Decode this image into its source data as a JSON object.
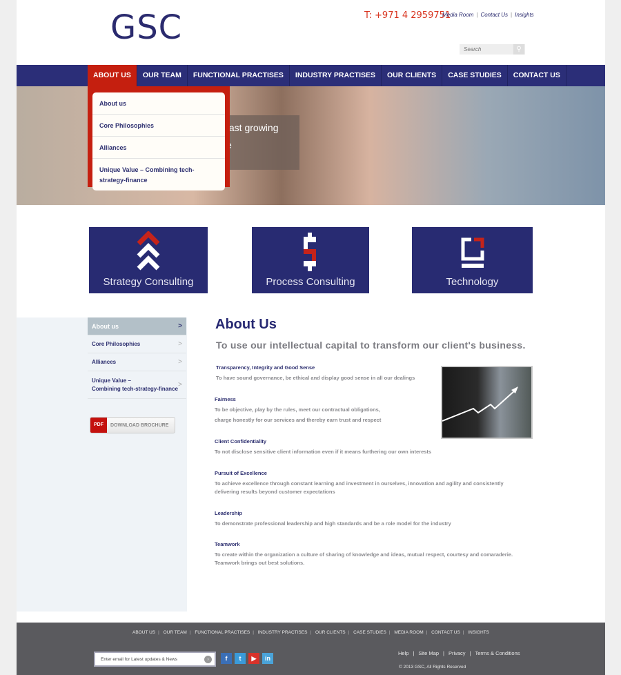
{
  "header": {
    "logo": "GSC",
    "phone": "T: +971 4 2959751",
    "top_links": [
      "Media Room",
      "Contact Us",
      "Insights"
    ],
    "search_placeholder": "Search"
  },
  "nav": {
    "items": [
      "ABOUT US",
      "OUR TEAM",
      "FUNCTIONAL PRACTISES",
      "INDUSTRY PRACTISES",
      "OUR CLIENTS",
      "CASE STUDIES",
      "CONTACT US"
    ],
    "active": "ABOUT US"
  },
  "dropdown": {
    "items": [
      "About us",
      "Core Philosophies",
      "Alliances",
      "Unique Value – Combining tech-strategy-finance"
    ]
  },
  "hero": {
    "caption_line1": "fast growing",
    "caption_line2": "e"
  },
  "tiles": [
    {
      "label": "Strategy Consulting",
      "icon": "chevrons-up-icon"
    },
    {
      "label": "Process Consulting",
      "icon": "dollar-icon"
    },
    {
      "label": "Technology",
      "icon": "technology-frame-icon"
    }
  ],
  "sidebar": {
    "items": [
      "About us",
      "Core Philosophies",
      "Alliances",
      "Unique Value –",
      "Combining tech-strategy-finance"
    ],
    "pdf_tag": "PDF",
    "pdf_label": "DOWNLOAD BROCHURE"
  },
  "main": {
    "title": "About Us",
    "subtitle": "To use our intellectual capital to transform our client's business.",
    "values": [
      {
        "title": "Transparency, Integrity and Good Sense",
        "lines": [
          "To have sound governance, be ethical and display good sense in all our dealings"
        ]
      },
      {
        "title": "Fairness",
        "lines": [
          "To be objective, play by the rules, meet our contractual obligations,",
          "charge honestly for our services and thereby earn trust and respect"
        ]
      },
      {
        "title": "Client Confidentiality",
        "lines": [
          "To not disclose sensitive client information even if it means furthering our own interests"
        ]
      },
      {
        "title": "Pursuit of Excellence",
        "lines": [
          "To achieve excellence through constant learning and investment in ourselves, innovation and agility and consistently",
          "delivering results beyond customer expectations"
        ]
      },
      {
        "title": "Leadership",
        "lines": [
          "To demonstrate professional leadership and high standards and be a role model for the industry"
        ]
      },
      {
        "title": "Teamwork",
        "lines": [
          "To create within the organization a culture of sharing of knowledge and ideas, mutual respect, courtesy and comaraderie.",
          "Teamwork brings out best solutions."
        ]
      }
    ]
  },
  "footer": {
    "links": [
      "ABOUT US",
      "OUR TEAM",
      "FUNCTIONAL PRACTISES",
      "INDUSTRY PRACTISES",
      "OUR CLIENTS",
      "CASE STUDIES",
      "MEDIA ROOM",
      "CONTACT US",
      "INSIGHTS"
    ],
    "email_placeholder": "Enter email for Latest updates & News",
    "social": [
      {
        "name": "facebook-icon",
        "glyph": "f",
        "color": "#3b6fb6"
      },
      {
        "name": "twitter-icon",
        "glyph": "t",
        "color": "#3a9ad9"
      },
      {
        "name": "youtube-icon",
        "glyph": "▶",
        "color": "#d8322a"
      },
      {
        "name": "linkedin-icon",
        "glyph": "in",
        "color": "#4aa3d8"
      }
    ],
    "legal": [
      "Help",
      "Site Map",
      "Privacy",
      "Terms & Conditions"
    ],
    "copyright": "© 2013 GSC, All Rights Reserved"
  },
  "colors": {
    "brand_blue": "#2b2e78",
    "brand_red": "#c51f0f",
    "footer": "#5a5a5e"
  }
}
